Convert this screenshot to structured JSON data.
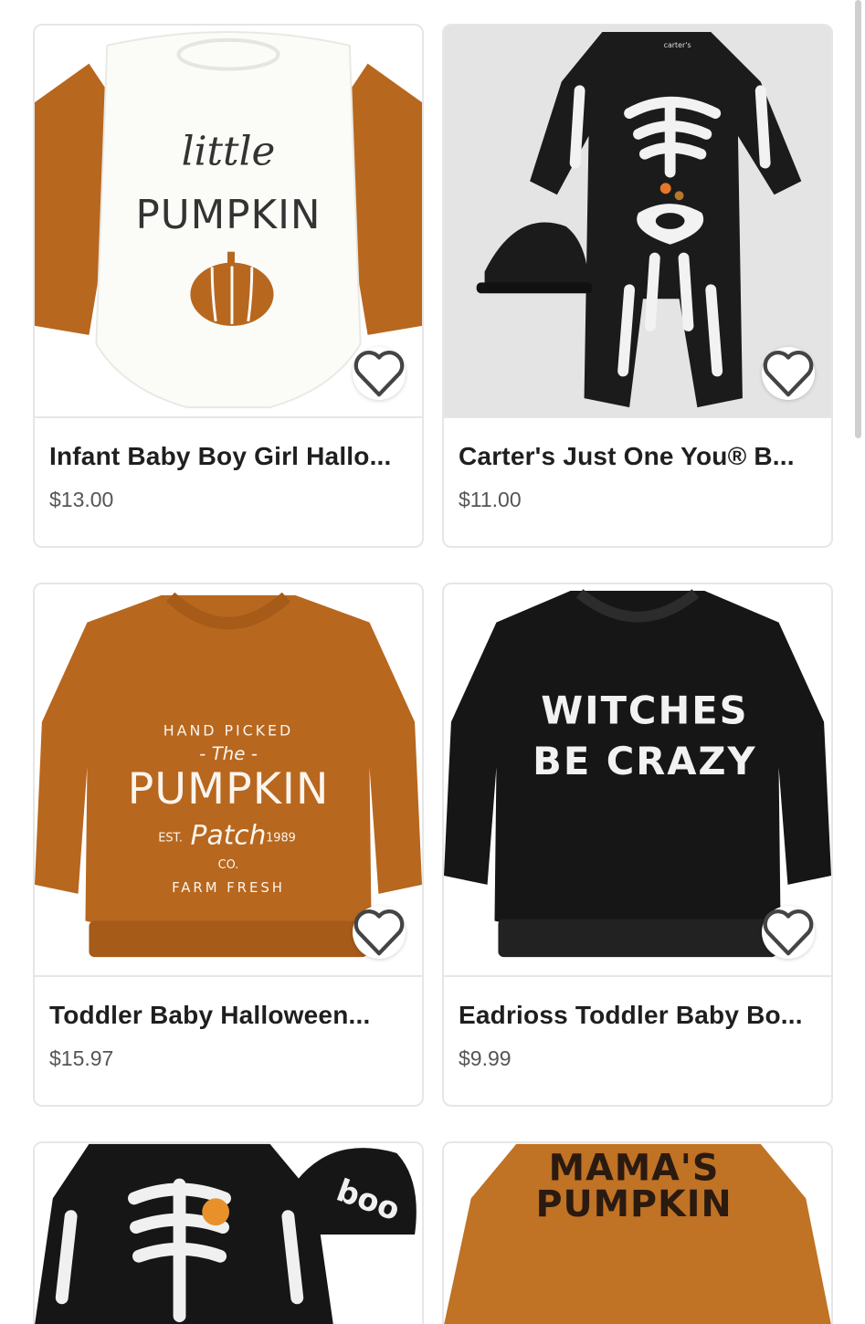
{
  "products": [
    {
      "title": "Infant Baby Boy Girl Hallo...",
      "price": "$13.00",
      "image_text": [
        "little",
        "PUMPKIN"
      ]
    },
    {
      "title": "Carter's Just One You® B...",
      "price": "$11.00",
      "image_text": [
        "carter's"
      ]
    },
    {
      "title": "Toddler Baby Halloween...",
      "price": "$15.97",
      "image_text": [
        "HAND PICKED",
        "- The -",
        "PUMPKIN",
        "EST.",
        "Patch",
        "1989",
        "CO.",
        "FARM FRESH"
      ]
    },
    {
      "title": "Eadrioss Toddler Baby Bo...",
      "price": "$9.99",
      "image_text": [
        "WITCHES",
        "BE CRAZY"
      ]
    },
    {
      "image_text": [
        "boo"
      ]
    },
    {
      "image_text": [
        "MAMA'S",
        "PUMPKIN"
      ]
    }
  ],
  "icons": {
    "favorite": "heart-outline-icon"
  },
  "colors": {
    "pumpkin": "#b8671e",
    "black": "#1a1a1a",
    "border": "#e6e6e6",
    "price": "#555555"
  }
}
